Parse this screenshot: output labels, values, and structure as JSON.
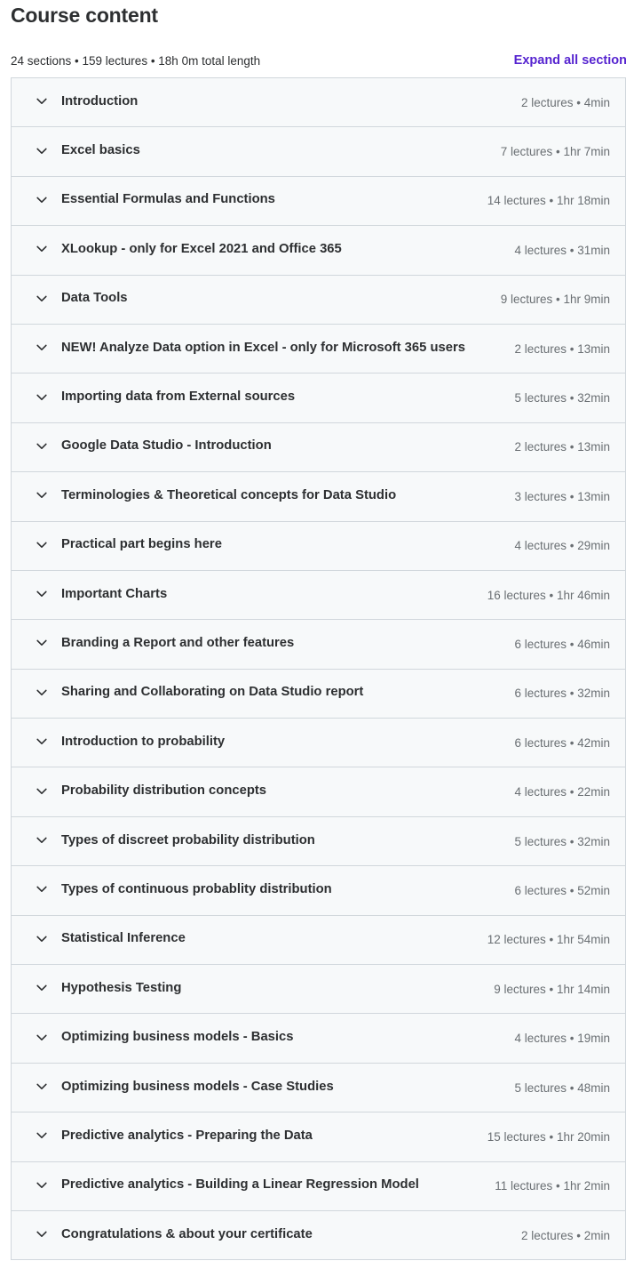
{
  "page": {
    "title": "Course content",
    "summary": "24 sections • 159 lectures • 18h 0m total length",
    "expand_all_label": "Expand all section"
  },
  "colors": {
    "accent": "#5624d0",
    "section_bg": "#f7f9fa",
    "border": "#d1d7dc",
    "text": "#2d2f31",
    "muted_text": "#6a6f73"
  },
  "icons": {
    "section_toggle": "chevron-down-icon"
  },
  "sections": [
    {
      "title": "Introduction",
      "meta": "2 lectures • 4min"
    },
    {
      "title": "Excel basics",
      "meta": "7 lectures • 1hr 7min"
    },
    {
      "title": "Essential Formulas and Functions",
      "meta": "14 lectures • 1hr 18min"
    },
    {
      "title": "XLookup - only for Excel 2021 and Office 365",
      "meta": "4 lectures • 31min"
    },
    {
      "title": "Data Tools",
      "meta": "9 lectures • 1hr 9min"
    },
    {
      "title": "NEW! Analyze Data option in Excel - only for Microsoft 365 users",
      "meta": "2 lectures • 13min"
    },
    {
      "title": "Importing data from External sources",
      "meta": "5 lectures • 32min"
    },
    {
      "title": "Google Data Studio - Introduction",
      "meta": "2 lectures • 13min"
    },
    {
      "title": "Terminologies & Theoretical concepts for Data Studio",
      "meta": "3 lectures • 13min"
    },
    {
      "title": "Practical part begins here",
      "meta": "4 lectures • 29min"
    },
    {
      "title": "Important Charts",
      "meta": "16 lectures • 1hr 46min"
    },
    {
      "title": "Branding a Report and other features",
      "meta": "6 lectures • 46min"
    },
    {
      "title": "Sharing and Collaborating on Data Studio report",
      "meta": "6 lectures • 32min"
    },
    {
      "title": "Introduction to probability",
      "meta": "6 lectures • 42min"
    },
    {
      "title": "Probability distribution concepts",
      "meta": "4 lectures • 22min"
    },
    {
      "title": "Types of discreet probability distribution",
      "meta": "5 lectures • 32min"
    },
    {
      "title": "Types of continuous probablity distribution",
      "meta": "6 lectures • 52min"
    },
    {
      "title": "Statistical Inference",
      "meta": "12 lectures • 1hr 54min"
    },
    {
      "title": "Hypothesis Testing",
      "meta": "9 lectures • 1hr 14min"
    },
    {
      "title": "Optimizing business models - Basics",
      "meta": "4 lectures • 19min"
    },
    {
      "title": "Optimizing business models - Case Studies",
      "meta": "5 lectures • 48min"
    },
    {
      "title": "Predictive analytics - Preparing the Data",
      "meta": "15 lectures • 1hr 20min"
    },
    {
      "title": "Predictive analytics - Building a Linear Regression Model",
      "meta": "11 lectures • 1hr 2min"
    },
    {
      "title": "Congratulations & about your certificate",
      "meta": "2 lectures • 2min"
    }
  ]
}
